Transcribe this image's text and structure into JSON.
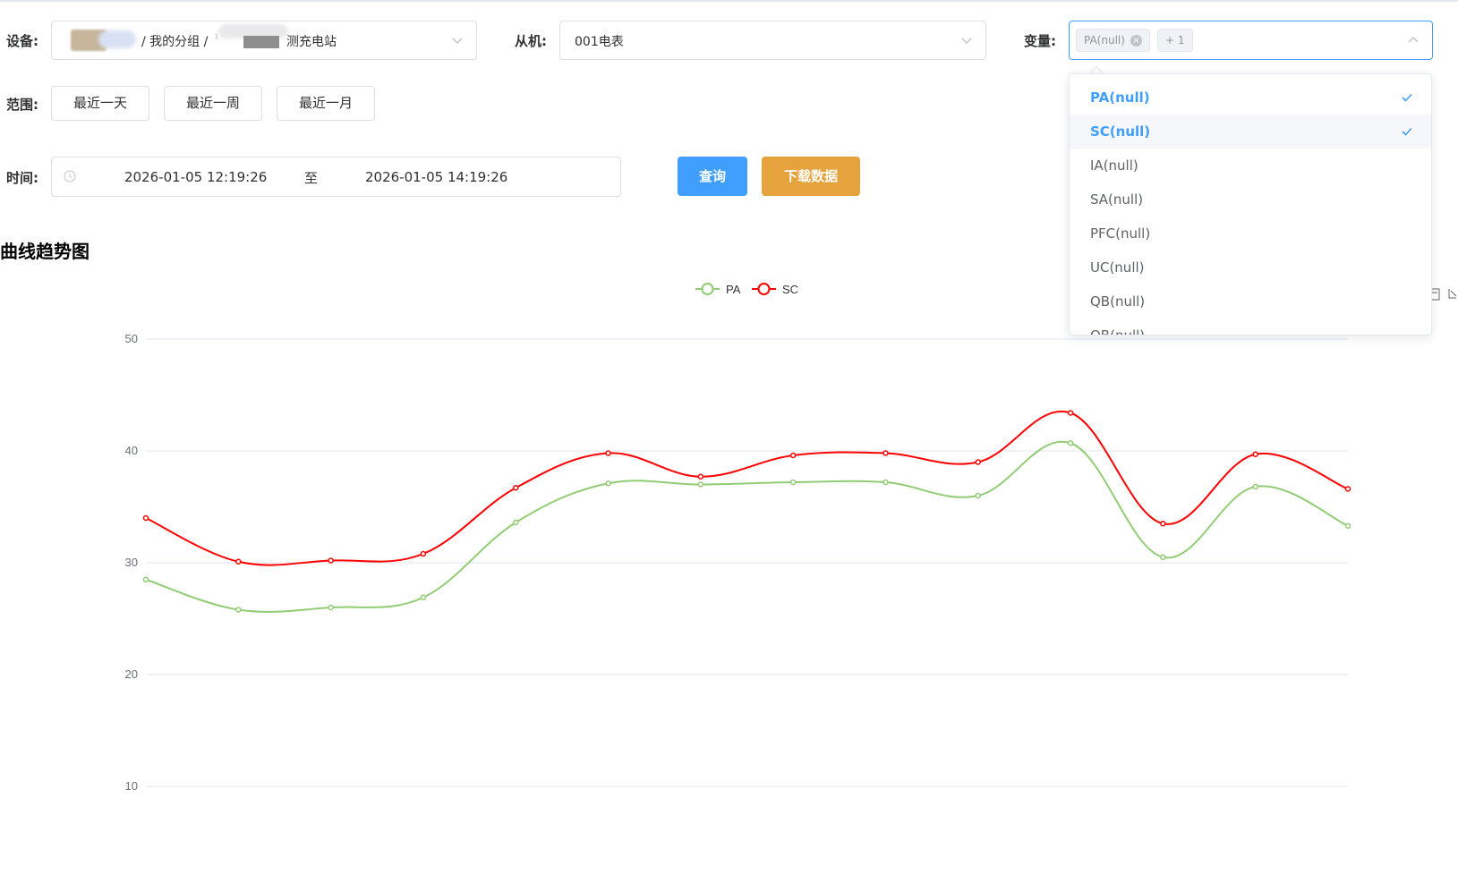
{
  "filters": {
    "device_label": "设备:",
    "device_path_mid": "/ 我的分组 / ",
    "device_path_end": "测充电站",
    "device_path_frag": "¹",
    "slave_label": "从机:",
    "slave_value": "001电表",
    "variable_label": "变量:",
    "variable_tag": "PA(null)",
    "variable_more": "+ 1",
    "range_label": "范围:",
    "range_buttons": [
      "最近一天",
      "最近一周",
      "最近一月"
    ],
    "time_label": "时间:",
    "time_start": "2026-01-05 12:19:26",
    "time_sep": "至",
    "time_end": "2026-01-05 14:19:26",
    "query_button": "查询",
    "download_button": "下载数据",
    "query_color": "#409eff",
    "download_color": "#e6a23c"
  },
  "section_title": "曲线趋势图",
  "dropdown": {
    "items": [
      {
        "label": "PA(null)",
        "selected": true
      },
      {
        "label": "SC(null)",
        "selected": true,
        "hover": true
      },
      {
        "label": "IA(null)",
        "selected": false
      },
      {
        "label": "SA(null)",
        "selected": false
      },
      {
        "label": "PFC(null)",
        "selected": false
      },
      {
        "label": "UC(null)",
        "selected": false
      },
      {
        "label": "QB(null)",
        "selected": false
      },
      {
        "label": "QB(null)",
        "selected": false
      }
    ]
  },
  "chart_data": {
    "type": "line",
    "smooth": true,
    "x": [
      1,
      2,
      3,
      4,
      5,
      6,
      7,
      8,
      9,
      10,
      11,
      12,
      13,
      14
    ],
    "ylim": [
      10,
      50
    ],
    "yticks": [
      10,
      20,
      30,
      40,
      50
    ],
    "grid": true,
    "legend_position": "top-center",
    "series": [
      {
        "name": "PA",
        "color": "#91cc75",
        "values": [
          28.5,
          25.8,
          26.0,
          26.9,
          33.6,
          37.1,
          37.0,
          37.2,
          37.2,
          36.0,
          40.7,
          30.5,
          36.8,
          33.3
        ]
      },
      {
        "name": "SC",
        "color": "#ff0000",
        "values": [
          34.0,
          30.1,
          30.2,
          30.8,
          36.7,
          39.8,
          37.7,
          39.6,
          39.8,
          39.0,
          43.4,
          33.5,
          39.7,
          36.6
        ]
      }
    ]
  }
}
